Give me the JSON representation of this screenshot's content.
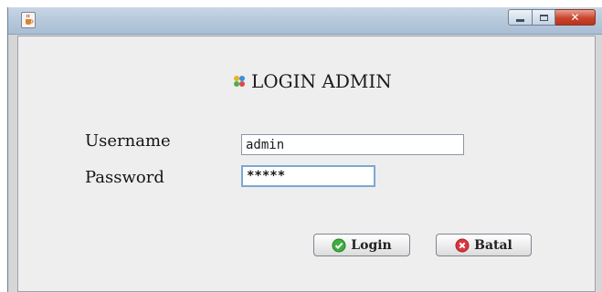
{
  "window": {
    "title": "",
    "controls": {
      "minimize": "minimize",
      "maximize": "maximize",
      "close": "close"
    }
  },
  "form": {
    "heading": "LOGIN ADMIN",
    "username_label": "Username",
    "username_value": "admin",
    "password_label": "Password",
    "password_value": "*****"
  },
  "buttons": {
    "login_label": "Login",
    "cancel_label": "Batal"
  },
  "icons": {
    "app": "java-cup-icon",
    "heading": "puzzle-leaf-icon",
    "login": "check-circle-icon",
    "cancel": "cancel-circle-icon"
  },
  "colors": {
    "login_icon": "#3fae3f",
    "cancel_icon": "#d9363e",
    "password_focus_border": "#7aa8d6"
  }
}
